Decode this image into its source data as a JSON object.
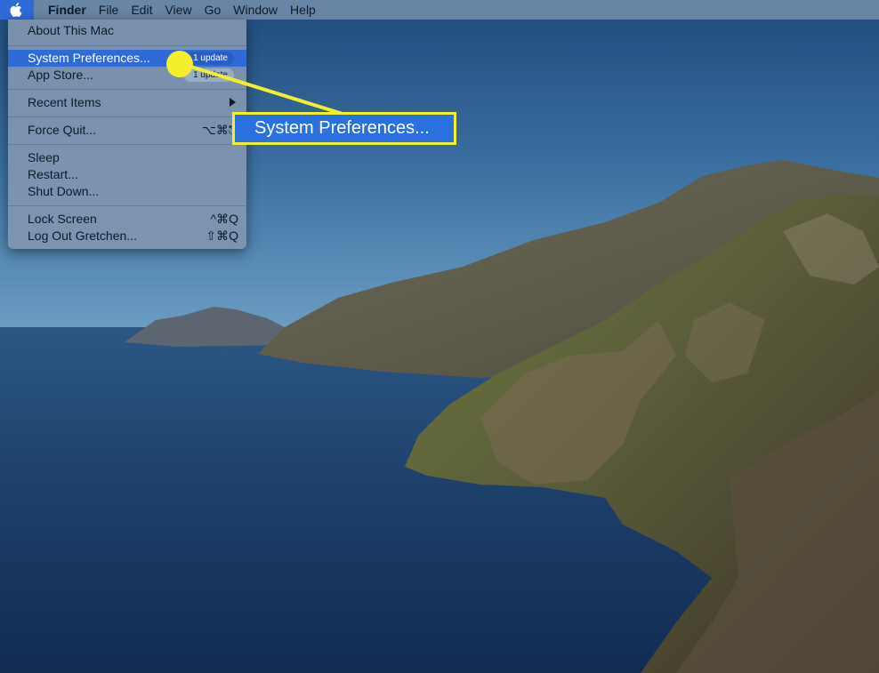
{
  "menubar": {
    "items": [
      "Finder",
      "File",
      "Edit",
      "View",
      "Go",
      "Window",
      "Help"
    ]
  },
  "apple_menu": {
    "about": "About This Mac",
    "system_prefs": "System Preferences...",
    "system_prefs_badge": "1 update",
    "app_store": "App Store...",
    "app_store_badge": "1 update",
    "recent_items": "Recent Items",
    "force_quit": "Force Quit...",
    "force_quit_shortcut": "⌥⌘⎋",
    "sleep": "Sleep",
    "restart": "Restart...",
    "shut_down": "Shut Down...",
    "lock_screen": "Lock Screen",
    "lock_screen_shortcut": "^⌘Q",
    "log_out": "Log Out Gretchen...",
    "log_out_shortcut": "⇧⌘Q"
  },
  "callout": {
    "label": "System Preferences..."
  },
  "colors": {
    "highlight": "#2f6ad6",
    "callout_border": "#f4ef2b"
  }
}
